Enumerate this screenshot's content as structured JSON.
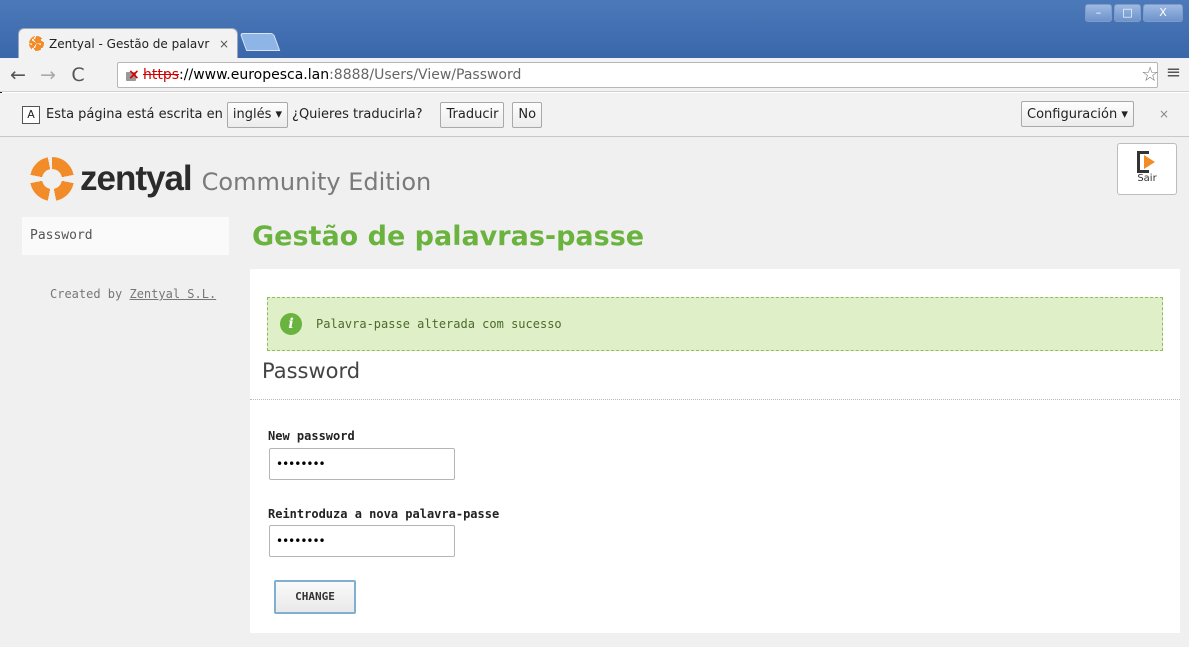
{
  "browser": {
    "tab_title": "Zentyal - Gestão de palavr",
    "tab_close": "×",
    "url_scheme": "https",
    "url_host": "://www.europesca.lan",
    "url_rest": ":8888/Users/View/Password",
    "window_buttons": [
      "–",
      "□",
      "X"
    ]
  },
  "translate_bar": {
    "message": "Esta página está escrita en",
    "language": "inglés ▾",
    "question": "¿Quieres traducirla?",
    "translate_button": "Traducir",
    "no_button": "No",
    "settings_button": "Configuración ▾",
    "close": "×"
  },
  "header": {
    "logo_word": "zentyal",
    "edition": "Community Edition",
    "logout_label": "Sair"
  },
  "sidebar": {
    "items": [
      {
        "label": "Password"
      }
    ],
    "credit_prefix": "Created by ",
    "credit_link": "Zentyal S.L."
  },
  "main": {
    "page_title": "Gestão de palavras-passe",
    "notice": "Palavra-passe alterada com sucesso",
    "section_title": "Password",
    "new_password_label": "New password",
    "new_password_value": "••••••••",
    "repeat_password_label": "Reintroduza a nova palavra-passe",
    "repeat_password_value": "••••••••",
    "change_button": "CHANGE"
  },
  "icons": {
    "accent_orange": "#f28c28",
    "accent_green": "#6ab33e"
  }
}
